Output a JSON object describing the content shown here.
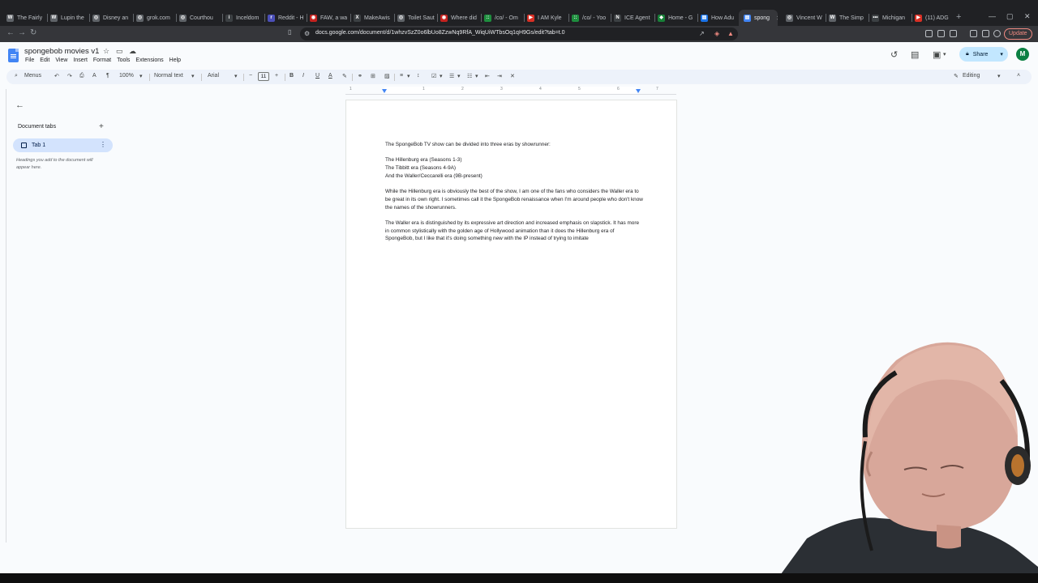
{
  "browser": {
    "tabs": [
      {
        "label": "The Fairly",
        "color": "#5f6368",
        "glyph": "W"
      },
      {
        "label": "Lupin the",
        "color": "#5f6368",
        "glyph": "W"
      },
      {
        "label": "Disney an",
        "color": "#5f6368",
        "glyph": "◎"
      },
      {
        "label": "grok.com",
        "color": "#5f6368",
        "glyph": "◎"
      },
      {
        "label": "Courthou",
        "color": "#5f6368",
        "glyph": "◎"
      },
      {
        "label": "Inceldom",
        "color": "#3c4043",
        "glyph": "i"
      },
      {
        "label": "Reddit - H",
        "color": "#4b4fb8",
        "glyph": "r"
      },
      {
        "label": "FAW, a wa",
        "color": "#c5221f",
        "glyph": "◉"
      },
      {
        "label": "MakeAwis",
        "color": "#3c4043",
        "glyph": "X"
      },
      {
        "label": "Toilet Saut",
        "color": "#5f6368",
        "glyph": "◎"
      },
      {
        "label": "Where did",
        "color": "#c5221f",
        "glyph": "◉"
      },
      {
        "label": "/co/ - Om",
        "color": "#1e8e3e",
        "glyph": "::"
      },
      {
        "label": "I AM Kyle",
        "color": "#d93025",
        "glyph": "▶"
      },
      {
        "label": "/co/ - Yoo",
        "color": "#1e8e3e",
        "glyph": "::"
      },
      {
        "label": "ICE Agent",
        "color": "#3c4043",
        "glyph": "N"
      },
      {
        "label": "Home - G",
        "color": "#188038",
        "glyph": "◆"
      },
      {
        "label": "How Adu",
        "color": "#1a73e8",
        "glyph": "▤"
      },
      {
        "label": "spong",
        "color": "#4285f4",
        "glyph": "▤"
      },
      {
        "label": "Vincent W",
        "color": "#5f6368",
        "glyph": "◎"
      },
      {
        "label": "The Simp",
        "color": "#5f6368",
        "glyph": "W"
      },
      {
        "label": "Michigan",
        "color": "#3c4043",
        "glyph": "•••"
      },
      {
        "label": "(11) ADG",
        "color": "#d93025",
        "glyph": "▶"
      }
    ],
    "active_tab_index": 17,
    "url": "docs.google.com/document/d/1whzvSzZ0o6lbUo8ZzwNq9RfA_WiqUiWTbsOq1qH9Gs/edit?tab=t.0",
    "update_label": "Update"
  },
  "docs": {
    "title": "spongebob movies v1",
    "menu": [
      "File",
      "Edit",
      "View",
      "Insert",
      "Format",
      "Tools",
      "Extensions",
      "Help"
    ],
    "share_label": "Share",
    "avatar_letter": "M",
    "toolbar": {
      "menus_label": "Menus",
      "zoom": "100%",
      "style": "Normal text",
      "font": "Arial",
      "font_size": "11",
      "mode": "Editing"
    },
    "sidebar": {
      "section_label": "Document tabs",
      "tab_label": "Tab 1",
      "hint": "Headings you add to the document will appear here."
    },
    "ruler_numbers": [
      "1",
      "1",
      "2",
      "3",
      "4",
      "5",
      "6",
      "7"
    ],
    "body": {
      "p1": "The SpongeBob TV show can be divided into three eras by showrunner:",
      "list": [
        "The Hillenburg era (Seasons 1-3)",
        "The Tibbitt era (Seasons 4-9A)",
        "And the Waller/Ceccarelli era (9B-present)"
      ],
      "p2": "While the Hillenburg era is obviously the best of the show, I am one of the fans who considers the Waller era to be great in its own right. I sometimes call it the SpongeBob renaissance when I'm around people who don't know the names of the showrunners.",
      "p3": "The Waller era is distinguished by its expressive art direction and increased emphasis on slapstick. It has more in common stylistically with the golden age of Hollywood animation than it does the Hillenburg era of SpongeBob, but I like that it's doing something new with the IP instead of trying to imitate"
    }
  }
}
